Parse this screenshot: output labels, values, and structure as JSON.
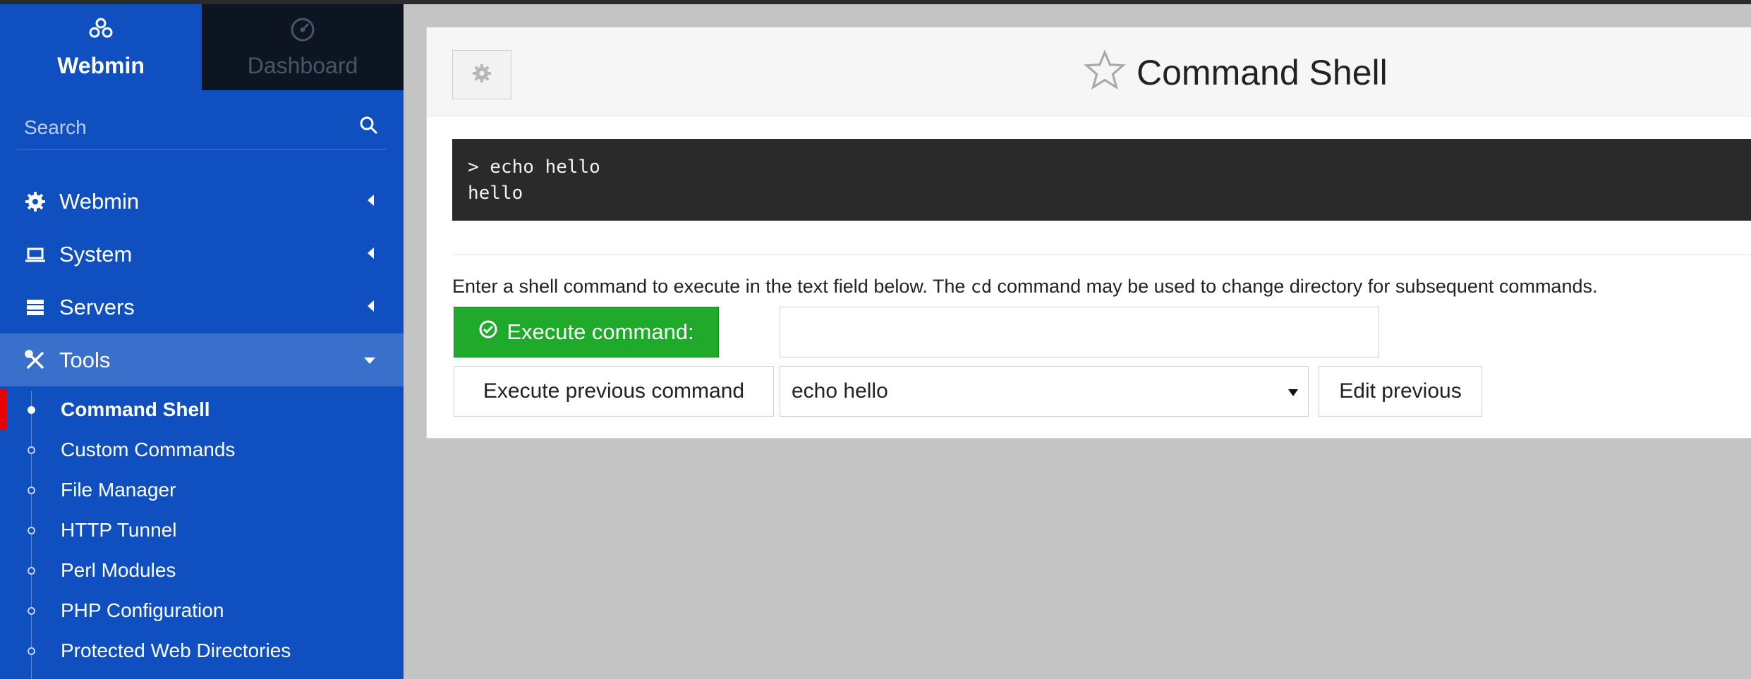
{
  "sidebar": {
    "tabs": [
      {
        "label": "Webmin",
        "icon": "webmin-logo-icon",
        "active": true
      },
      {
        "label": "Dashboard",
        "icon": "dashboard-gauge-icon",
        "active": false
      }
    ],
    "search": {
      "placeholder": "Search",
      "icon": "search-icon"
    },
    "menu": [
      {
        "label": "Webmin",
        "icon": "gear-icon",
        "expanded": false
      },
      {
        "label": "System",
        "icon": "laptop-icon",
        "expanded": false
      },
      {
        "label": "Servers",
        "icon": "server-icon",
        "expanded": false
      },
      {
        "label": "Tools",
        "icon": "tools-icon",
        "expanded": true
      }
    ],
    "tools_items": [
      {
        "label": "Command Shell",
        "active": true
      },
      {
        "label": "Custom Commands",
        "active": false
      },
      {
        "label": "File Manager",
        "active": false
      },
      {
        "label": "HTTP Tunnel",
        "active": false
      },
      {
        "label": "Perl Modules",
        "active": false
      },
      {
        "label": "PHP Configuration",
        "active": false
      },
      {
        "label": "Protected Web Directories",
        "active": false
      }
    ]
  },
  "main": {
    "title": "Command Shell",
    "terminal_output": "> echo hello\nhello",
    "description_before": "Enter a shell command to execute in the text field below. The ",
    "description_code": "cd",
    "description_after": " command may be used to change directory for subsequent commands.",
    "execute_label": "Execute command:",
    "command_value": "",
    "execute_previous_label": "Execute previous command",
    "previous_selected": "echo hello",
    "edit_previous_label": "Edit previous"
  },
  "colors": {
    "sidebar_bg": "#0f4fbf",
    "sidebar_active_item": "#3a6fcc",
    "active_marker": "#e60000",
    "execute_button": "#1faa2b",
    "terminal_bg": "#2a2a2a"
  }
}
